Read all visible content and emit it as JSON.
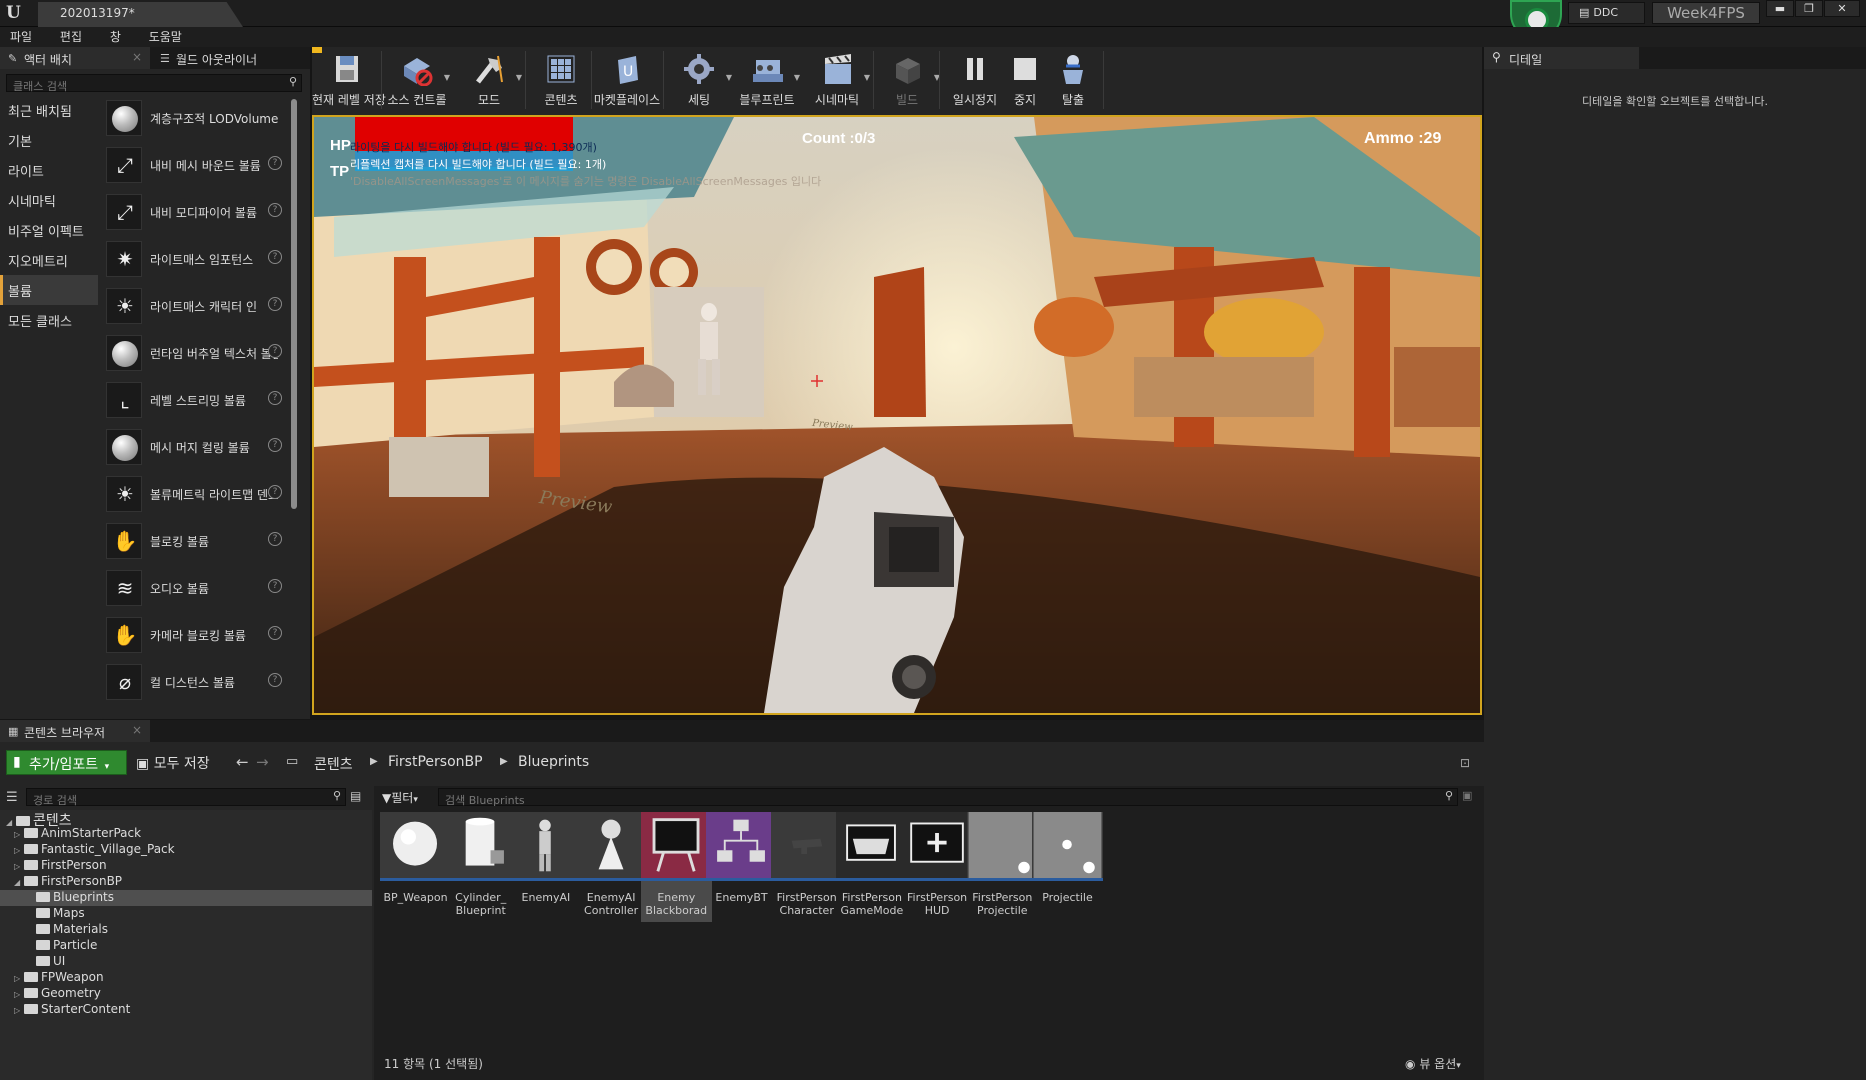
{
  "window": {
    "project_tab": "202013197*",
    "ddc_label": "DDC",
    "project_name": "Week4FPS",
    "min": "▬",
    "max": "❐",
    "close": "✕"
  },
  "menu": [
    "파일",
    "편집",
    "창",
    "도움말"
  ],
  "left_tabs": {
    "place_actors": "액터 배치",
    "world_outliner": "월드 아웃라이너"
  },
  "place_panel": {
    "search_placeholder": "클래스 검색",
    "categories": [
      "최근 배치됨",
      "기본",
      "라이트",
      "시네마틱",
      "비주얼 이펙트",
      "지오메트리",
      "볼륨",
      "모든 클래스"
    ],
    "active_category": "볼륨",
    "items": [
      {
        "label": "계층구조적 LODVolume",
        "icon": "sphere"
      },
      {
        "label": "내비 메시 바운드 볼륨",
        "icon": "nav-icon"
      },
      {
        "label": "내비 모디파이어 볼륨",
        "icon": "nav-icon"
      },
      {
        "label": "라이트매스 임포턴스",
        "icon": "lightmass-icon"
      },
      {
        "label": "라이트매스 캐릭터 인",
        "icon": "sun-icon"
      },
      {
        "label": "런타임 버추얼 텍스처 볼륨",
        "icon": "sphere"
      },
      {
        "label": "레벨 스트리밍 볼륨",
        "icon": "streaming-icon"
      },
      {
        "label": "메시 머지 컬링 볼륨",
        "icon": "sphere"
      },
      {
        "label": "볼류메트릭 라이트맵 덴스",
        "icon": "sun-icon"
      },
      {
        "label": "블로킹 볼륨",
        "icon": "hand-icon"
      },
      {
        "label": "오디오 볼륨",
        "icon": "audio-icon"
      },
      {
        "label": "카메라 블로킹 볼륨",
        "icon": "camera-hand-icon"
      },
      {
        "label": "컬 디스턴스 볼륨",
        "icon": "cull-icon"
      }
    ]
  },
  "toolbar": [
    {
      "label": "현재 레벨 저장",
      "dd": false
    },
    {
      "label": "소스 컨트롤",
      "dd": true
    },
    {
      "label": "모드",
      "dd": true
    },
    {
      "label": "콘텐츠",
      "dd": false
    },
    {
      "label": "마켓플레이스",
      "dd": false
    },
    {
      "label": "세팅",
      "dd": true
    },
    {
      "label": "블루프린트",
      "dd": true
    },
    {
      "label": "시네마틱",
      "dd": true
    },
    {
      "label": "빌드",
      "dd": true
    },
    {
      "label": "일시정지",
      "dd": false
    },
    {
      "label": "중지",
      "dd": false
    },
    {
      "label": "탈출",
      "dd": false
    }
  ],
  "viewport": {
    "hp_label": "HP",
    "tp_label": "TP",
    "count": "Count :0/3",
    "ammo": "Ammo :29",
    "msg1": "라이팅을 다시 빌드해야 합니다 (빌드 필요: 1,390개)",
    "msg2": "리플렉션 캡처를 다시 빌드해야 합니다 (빌드 필요: 1개)",
    "msg3": "'DisableAllScreenMessages'로 이 메시지를 숨기는 명령은 DisableAllScreenMessages 입니다",
    "preview1": "Preview",
    "preview2": "Preview",
    "hp_color": "#e00000",
    "tp_color": "#1e9fd8"
  },
  "details": {
    "tab": "디테일",
    "empty_msg": "디테일을 확인할 오브젝트를 선택합니다."
  },
  "content_browser": {
    "tab": "콘텐츠 브라우저",
    "add_import": "추가/임포트",
    "save_all": "모두 저장",
    "breadcrumb": [
      "콘텐츠",
      "FirstPersonBP",
      "Blueprints"
    ],
    "path_search_placeholder": "경로 검색",
    "filter": "필터",
    "asset_search_placeholder": "검색 Blueprints",
    "tree": [
      {
        "label": "콘텐츠",
        "depth": 0,
        "open": true
      },
      {
        "label": "AnimStarterPack",
        "depth": 1
      },
      {
        "label": "Fantastic_Village_Pack",
        "depth": 1
      },
      {
        "label": "FirstPerson",
        "depth": 1
      },
      {
        "label": "FirstPersonBP",
        "depth": 1,
        "open": true
      },
      {
        "label": "Blueprints",
        "depth": 2,
        "selected": true
      },
      {
        "label": "Maps",
        "depth": 2
      },
      {
        "label": "Materials",
        "depth": 2
      },
      {
        "label": "Particle",
        "depth": 2
      },
      {
        "label": "UI",
        "depth": 2
      },
      {
        "label": "FPWeapon",
        "depth": 1
      },
      {
        "label": "Geometry",
        "depth": 1
      },
      {
        "label": "StarterContent",
        "depth": 1
      }
    ],
    "assets": [
      {
        "name": "BP_Weapon",
        "kind": "sphere"
      },
      {
        "name": "Cylinder_ Blueprint",
        "kind": "cylinder"
      },
      {
        "name": "EnemyAI",
        "kind": "character"
      },
      {
        "name": "EnemyAI Controller",
        "kind": "pawn"
      },
      {
        "name": "Enemy Blackborad",
        "kind": "blackboard",
        "selected": true
      },
      {
        "name": "EnemyBT",
        "kind": "tree"
      },
      {
        "name": "FirstPerson Character",
        "kind": "gun"
      },
      {
        "name": "FirstPerson GameMode",
        "kind": "gamepad"
      },
      {
        "name": "FirstPerson HUD",
        "kind": "hud"
      },
      {
        "name": "FirstPerson Projectile",
        "kind": "grid"
      },
      {
        "name": "Projectile",
        "kind": "grid-ball"
      }
    ],
    "status": "11 항목 (1 선택됨)",
    "view_options": "뷰 옵션"
  }
}
